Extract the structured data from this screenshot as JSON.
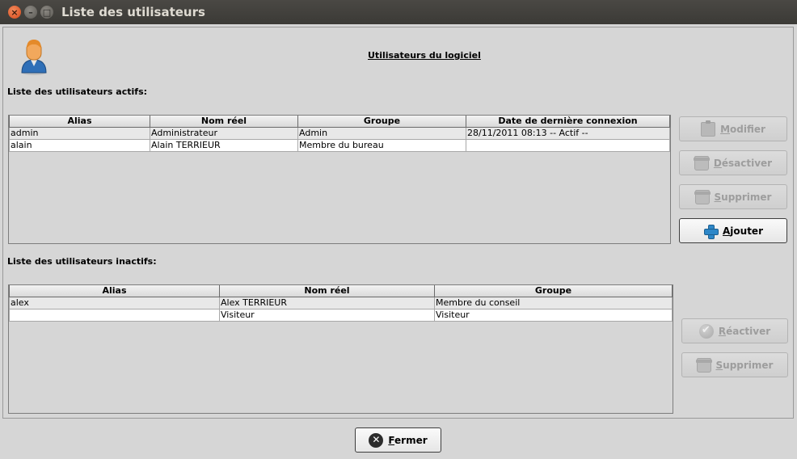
{
  "window": {
    "title": "Liste des utilisateurs",
    "controls": [
      "close-icon",
      "minimize-icon",
      "maximize-icon"
    ]
  },
  "header": {
    "title": "Utilisateurs du logiciel",
    "avatar_icon": "user-icon"
  },
  "active_users": {
    "label": "Liste des utilisateurs actifs:",
    "columns": [
      "Alias",
      "Nom réel",
      "Groupe",
      "Date de dernière connexion"
    ],
    "rows": [
      [
        "admin",
        "Administrateur",
        "Admin",
        "28/11/2011 08:13 -- Actif --"
      ],
      [
        "alain",
        "Alain TERRIEUR",
        "Membre du bureau",
        ""
      ]
    ]
  },
  "inactive_users": {
    "label": "Liste des utilisateurs inactifs:",
    "columns": [
      "Alias",
      "Nom réel",
      "Groupe"
    ],
    "rows": [
      [
        "alex",
        "Alex TERRIEUR",
        "Membre du conseil"
      ],
      [
        "",
        "Visiteur",
        "Visiteur"
      ]
    ]
  },
  "buttons": {
    "modifier": {
      "mnemonic": "M",
      "rest": "odifier",
      "icon": "clipboard-icon",
      "enabled": false
    },
    "desactiver": {
      "mnemonic": "D",
      "rest": "ésactiver",
      "icon": "trash-icon",
      "enabled": false
    },
    "supprimer_actifs": {
      "mnemonic": "S",
      "rest": "upprimer",
      "icon": "trash-icon",
      "enabled": false
    },
    "ajouter": {
      "mnemonic": "A",
      "rest": "jouter",
      "icon": "plus-icon",
      "enabled": true
    },
    "reactiver": {
      "mnemonic": "R",
      "rest": "éactiver",
      "icon": "check-icon",
      "enabled": false
    },
    "supprimer_inactifs": {
      "mnemonic": "S",
      "rest": "upprimer",
      "icon": "trash-icon",
      "enabled": false
    },
    "fermer": {
      "mnemonic": "F",
      "rest": "ermer",
      "icon": "close-circle-icon",
      "enabled": true
    }
  },
  "colors": {
    "titlebar": "#3b3a36",
    "window_bg": "#d6d6d6",
    "close_button": "#d6491a",
    "accent_plus": "#2d87c8"
  }
}
